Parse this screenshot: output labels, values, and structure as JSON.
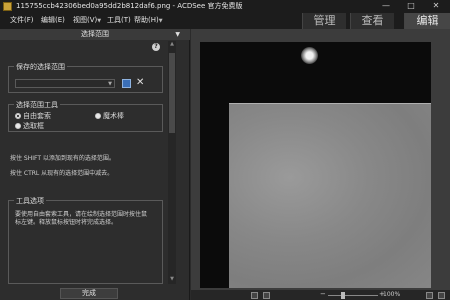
{
  "window": {
    "title": "115755ccb42306bed0a95dd2b812daf6.png - ACDSee 官方免费版",
    "minimize_glyph": "—",
    "maximize_glyph": "□",
    "close_glyph": "✕"
  },
  "menubar": {
    "items": [
      "文件(F)",
      "编辑(E)",
      "视图(V)",
      "工具(T)",
      "帮助(H)"
    ],
    "arrow": "▼"
  },
  "mode_tabs": [
    "管理",
    "查看",
    "编辑"
  ],
  "panel": {
    "header": "选择范围",
    "header_arrow": "▼",
    "help_glyph": "?",
    "saved_group": {
      "title": "保存的选择范围",
      "select_value": "",
      "select_arrow": "▼"
    },
    "tool_group": {
      "title": "选择范围工具",
      "options": [
        "自由套索",
        "魔术棒",
        "选取框"
      ],
      "selected": "自由套索"
    },
    "hints": [
      "按住 SHIFT 以添加到现有的选择范围。",
      "按住 CTRL 从现有的选择范围中减去。"
    ],
    "tips_group": {
      "title": "工具选项",
      "text": "要使用自由套索工具，请在绘制选择范围时按住鼠标左键。释放鼠标按钮时将完成选择。"
    },
    "done_label": "完成"
  },
  "statusbar": {
    "zoom": "100%",
    "minus": "−",
    "plus": "+"
  },
  "icons": [
    "app-icon",
    "save-selection-icon",
    "delete-selection-icon",
    "help-icon",
    "fit-icon",
    "actual-size-icon",
    "fullscreen-icon"
  ]
}
